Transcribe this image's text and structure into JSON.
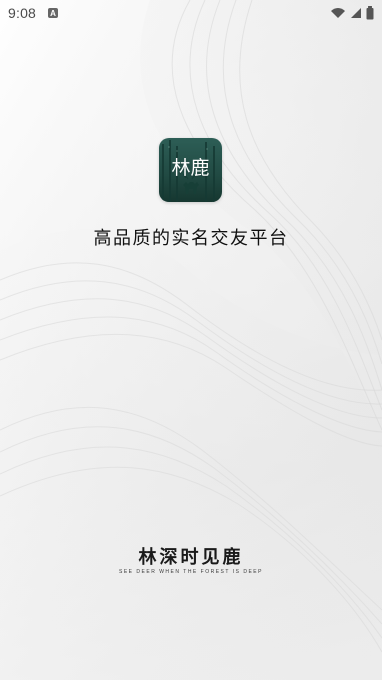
{
  "status_bar": {
    "time": "9:08",
    "notification_icon": "a-icon",
    "icons": [
      "wifi-icon",
      "signal-icon",
      "battery-icon"
    ]
  },
  "app": {
    "logo_text": "林鹿",
    "tagline": "高品质的实名交友平台",
    "footer_title": "林深时见鹿",
    "footer_subtitle": "SEE DEER WHEN THE FOREST IS DEEP"
  },
  "theme": {
    "logo_green": "#2d5e56",
    "background": "#f4f4f4",
    "text": "#111111"
  }
}
